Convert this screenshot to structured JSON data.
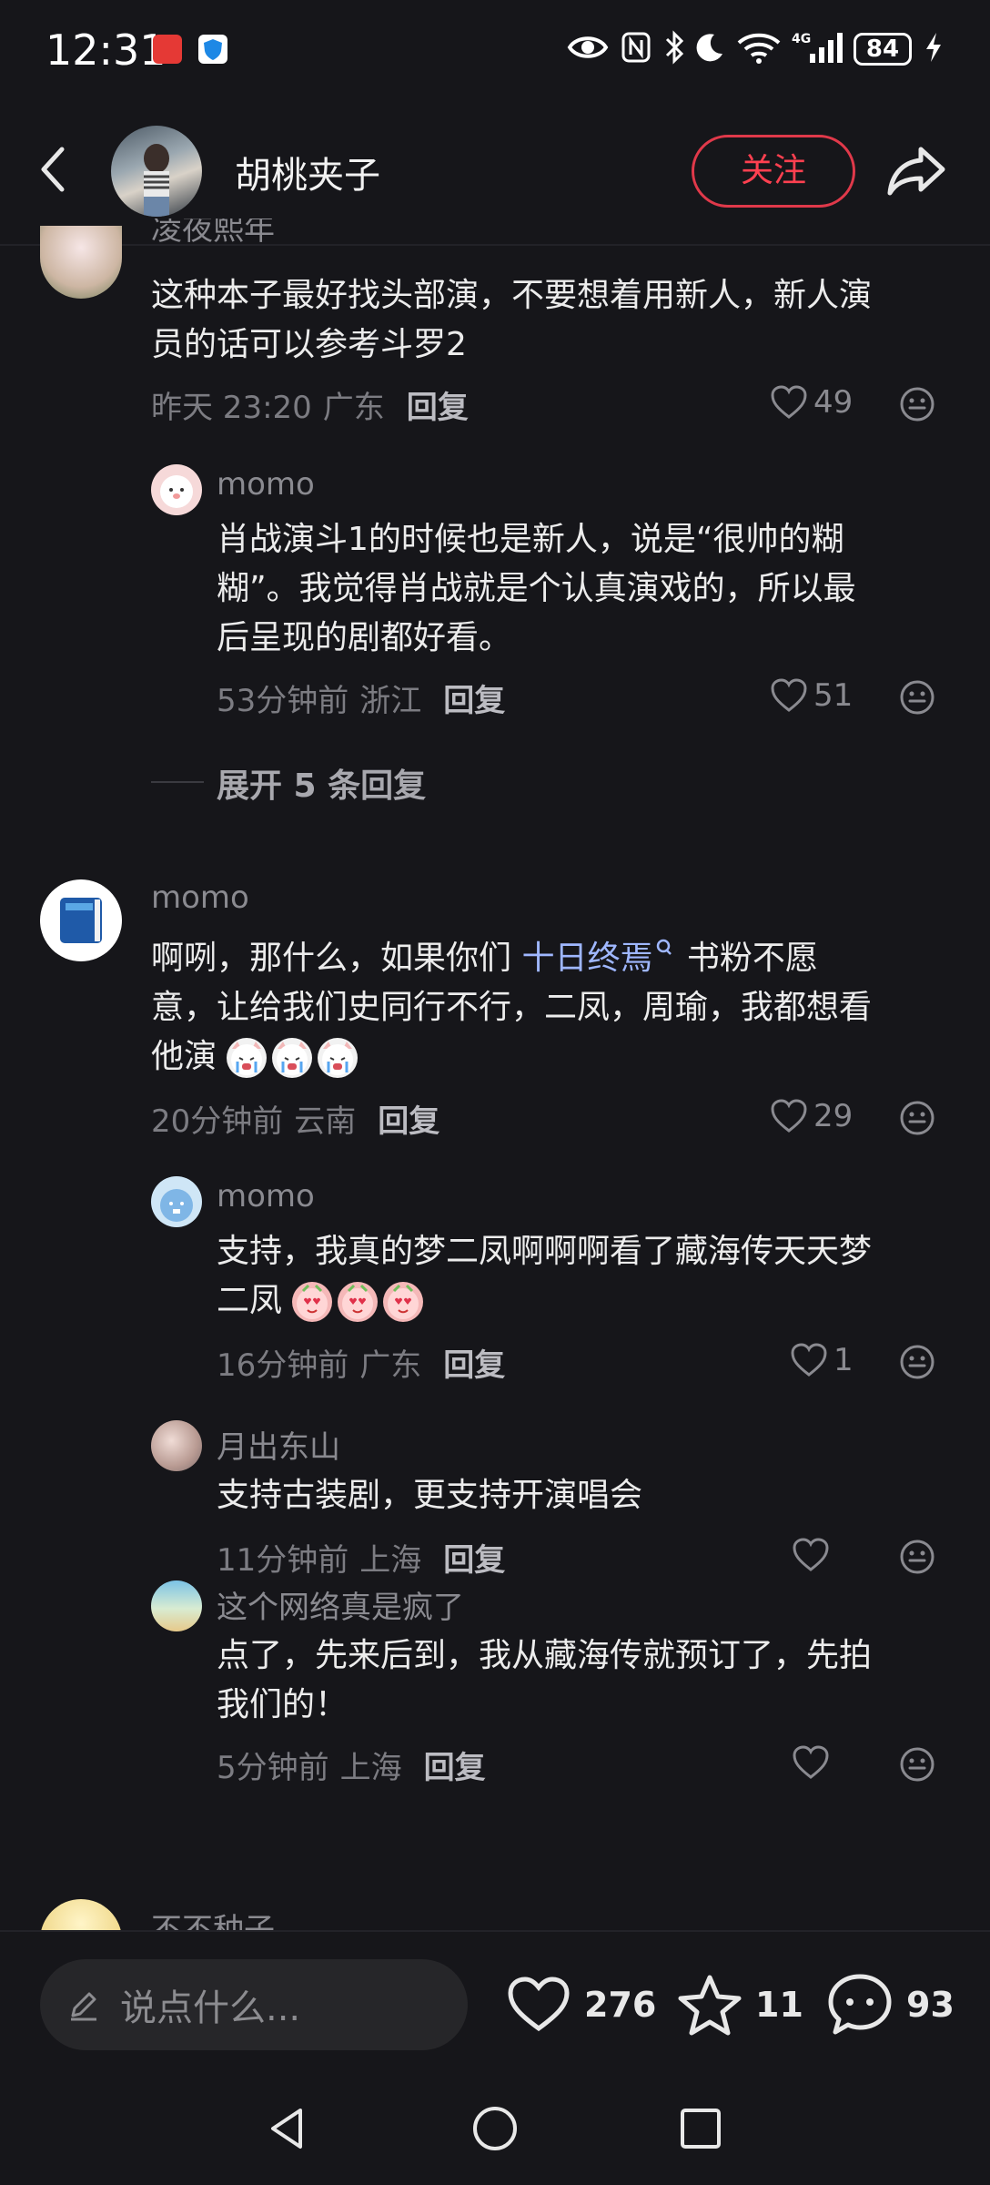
{
  "status_bar": {
    "time": "12:31",
    "battery": "84",
    "icons": [
      "eye-icon",
      "nfc-icon",
      "bluetooth-icon",
      "moon-icon",
      "wifi-icon",
      "signal-4g-icon",
      "charging-icon"
    ]
  },
  "header": {
    "author": "胡桃夹子",
    "follow_label": "关注"
  },
  "comments": [
    {
      "user": "凌夜熙年",
      "text_lines": [
        "这种本子最好找头部演，不要想着用新人，新人演",
        "员的话可以参考斗罗2"
      ],
      "time": "昨天 23:20",
      "location": "广东",
      "reply_label": "回复",
      "likes": "49",
      "replies": [
        {
          "user": "momo",
          "text_lines": [
            "肖战演斗1的时候也是新人，说是“很帅的糊",
            "糊”。我觉得肖战就是个认真演戏的，所以最",
            "后呈现的剧都好看。"
          ],
          "time": "53分钟前",
          "location": "浙江",
          "reply_label": "回复",
          "likes": "51"
        }
      ],
      "expand_label": "展开 5 条回复"
    },
    {
      "user": "momo",
      "text_line1_a": "啊咧，那什么，如果你们 ",
      "text_line1_link": "十日终焉",
      "text_line1_b": " 书粉不愿",
      "text_line2": "意，让给我们史同行不行，二凤，周瑜，我都想看",
      "text_line3": "他演",
      "time": "20分钟前",
      "location": "云南",
      "reply_label": "回复",
      "likes": "29",
      "replies": [
        {
          "user": "momo",
          "text_lines": [
            "支持，我真的梦二凤啊啊啊看了藏海传天天梦",
            "二凤"
          ],
          "time": "16分钟前",
          "location": "广东",
          "reply_label": "回复",
          "likes": "1"
        },
        {
          "user": "月出东山",
          "text_lines": [
            "支持古装剧，更支持开演唱会"
          ],
          "time": "11分钟前",
          "location": "上海",
          "reply_label": "回复",
          "likes": ""
        },
        {
          "user": "这个网络真是疯了",
          "text_lines": [
            "点了，先来后到，我从藏海传就预订了，先拍",
            "我们的！"
          ],
          "time": "5分钟前",
          "location": "上海",
          "reply_label": "回复",
          "likes": ""
        }
      ]
    },
    {
      "user": "不不种子"
    }
  ],
  "bottom_bar": {
    "placeholder": "说点什么...",
    "like_count": "276",
    "star_count": "11",
    "comment_count": "93"
  }
}
